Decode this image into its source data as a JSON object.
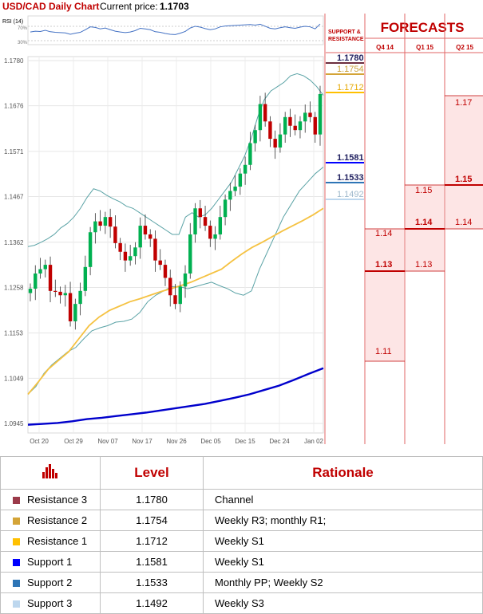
{
  "header": {
    "title": "USD/CAD Daily Chart",
    "price_label": "Current price:",
    "price_value": "1.1703"
  },
  "rsi": {
    "label": "RSI (14)",
    "upper": "70%",
    "lower": "30%"
  },
  "levels_panel": {
    "heading": "SUPPORT & RESISTANCE"
  },
  "forecasts": {
    "title": "FORECASTS",
    "periods": [
      "Q4 14",
      "Q1 15",
      "Q2 15"
    ],
    "columns": [
      {
        "period": "Q4 14",
        "levels": [
          "1.14",
          "1.13",
          "1.11"
        ],
        "bold": "1.13"
      },
      {
        "period": "Q1 15",
        "levels": [
          "1.15",
          "1.14",
          "1.13"
        ],
        "bold": "1.14"
      },
      {
        "period": "Q2 15",
        "levels": [
          "1.17",
          "1.15",
          "1.14"
        ],
        "bold": "1.15"
      }
    ]
  },
  "chart_data": {
    "type": "candlestick",
    "title": "USD/CAD Daily Chart",
    "ylim": [
      1.0945,
      1.178
    ],
    "y_ticks": [
      "1.1780",
      "1.1676",
      "1.1571",
      "1.1467",
      "1.1362",
      "1.1258",
      "1.1153",
      "1.1049",
      "1.0945"
    ],
    "x_ticks": [
      "Oct 20",
      "Oct 29",
      "Nov 07",
      "Nov 17",
      "Nov 26",
      "Dec 05",
      "Dec 15",
      "Dec 24",
      "Jan 02"
    ],
    "closes": [
      1.1255,
      1.129,
      1.13,
      1.131,
      1.125,
      1.1248,
      1.124,
      1.1245,
      1.118,
      1.122,
      1.125,
      1.1305,
      1.1385,
      1.141,
      1.14,
      1.142,
      1.1398,
      1.136,
      1.134,
      1.132,
      1.133,
      1.135,
      1.14,
      1.138,
      1.137,
      1.132,
      1.131,
      1.128,
      1.124,
      1.122,
      1.126,
      1.129,
      1.138,
      1.144,
      1.142,
      1.14,
      1.137,
      1.138,
      1.142,
      1.146,
      1.148,
      1.149,
      1.152,
      1.154,
      1.159,
      1.162,
      1.168,
      1.164,
      1.16,
      1.158,
      1.161,
      1.165,
      1.163,
      1.162,
      1.164,
      1.166,
      1.165,
      1.161,
      1.1703
    ],
    "rsi_values": [
      44,
      47,
      46,
      50,
      45,
      43,
      42,
      41,
      36,
      40,
      43,
      52,
      62,
      60,
      55,
      58,
      52,
      47,
      44,
      42,
      44,
      49,
      57,
      55,
      52,
      45,
      43,
      39,
      36,
      35,
      40,
      46,
      58,
      64,
      61,
      56,
      52,
      55,
      62,
      65,
      66,
      67,
      68,
      69,
      70,
      68,
      71,
      64,
      57,
      55,
      59,
      62,
      59,
      57,
      61,
      64,
      62,
      55,
      72
    ],
    "series": [
      {
        "name": "Bollinger Band upper",
        "color": "#5ba3a6",
        "values": [
          1.1352,
          1.1355,
          1.1362,
          1.137,
          1.138,
          1.1395,
          1.1405,
          1.142,
          1.144,
          1.1465,
          1.1485,
          1.148,
          1.147,
          1.1462,
          1.1455,
          1.1445,
          1.144,
          1.143,
          1.142,
          1.141,
          1.14,
          1.139,
          1.138,
          1.138,
          1.142,
          1.143,
          1.142,
          1.1425,
          1.144,
          1.146,
          1.148,
          1.15,
          1.153,
          1.156,
          1.16,
          1.165,
          1.169,
          1.171,
          1.172,
          1.173,
          1.1745,
          1.175,
          1.1745,
          1.1735,
          1.172,
          1.17
        ]
      },
      {
        "name": "Bollinger Band lower",
        "color": "#5ba3a6",
        "values": [
          1.1012,
          1.103,
          1.106,
          1.108,
          1.1095,
          1.111,
          1.112,
          1.114,
          1.1158,
          1.1165,
          1.117,
          1.1178,
          1.118,
          1.1185,
          1.12,
          1.1225,
          1.124,
          1.125,
          1.126,
          1.126,
          1.1255,
          1.126,
          1.1265,
          1.127,
          1.1262,
          1.1255,
          1.1245,
          1.124,
          1.125,
          1.13,
          1.134,
          1.138,
          1.142,
          1.145,
          1.148,
          1.15,
          1.152,
          1.1535
        ]
      },
      {
        "name": "Moving average fast",
        "color": "#f5c242",
        "values": [
          1.1012,
          1.104,
          1.107,
          1.109,
          1.111,
          1.114,
          1.117,
          1.119,
          1.1205,
          1.1215,
          1.1225,
          1.1232,
          1.124,
          1.1248,
          1.1255,
          1.1262,
          1.127,
          1.128,
          1.129,
          1.13,
          1.1318,
          1.1335,
          1.135,
          1.1362,
          1.1375,
          1.1388,
          1.14,
          1.1412,
          1.1425,
          1.144
        ]
      },
      {
        "name": "Moving average slow",
        "color": "#0000cc",
        "values": [
          1.0942,
          1.0944,
          1.0946,
          1.095,
          1.0955,
          1.0958,
          1.0962,
          1.0966,
          1.097,
          1.0975,
          1.098,
          1.0985,
          1.099,
          1.0997,
          1.1004,
          1.1012,
          1.1022,
          1.1032,
          1.1045,
          1.1059,
          1.1072
        ]
      }
    ],
    "levels": [
      {
        "label": "1.1780",
        "value": 1.178,
        "color": "#6b2d3e"
      },
      {
        "label": "1.1754",
        "value": 1.1754,
        "color": "#d4a437"
      },
      {
        "label": "1.1712",
        "value": 1.1712,
        "color": "#ffc000"
      },
      {
        "label": "1.1581",
        "value": 1.1581,
        "color": "#0000ff"
      },
      {
        "label": "1.1533",
        "value": 1.1533,
        "color": "#2e75b6"
      },
      {
        "label": "1.1492",
        "value": 1.1492,
        "color": "#bdd7ee"
      }
    ],
    "colors": {
      "up": "#00b050",
      "down": "#c00000"
    }
  },
  "table": {
    "headers": [
      "",
      "Level",
      "Rationale"
    ],
    "rows": [
      {
        "name": "Resistance 3",
        "level": "1.1780",
        "rationale": "Channel",
        "color": "#9b3a4a"
      },
      {
        "name": "Resistance 2",
        "level": "1.1754",
        "rationale": "Weekly R3; monthly R1;",
        "color": "#d4a437"
      },
      {
        "name": "Resistance 1",
        "level": "1.1712",
        "rationale": "Weekly S1",
        "color": "#ffc000"
      },
      {
        "name": "Support 1",
        "level": "1.1581",
        "rationale": "Weekly S1",
        "color": "#0000ff"
      },
      {
        "name": "Support 2",
        "level": "1.1533",
        "rationale": "Monthly PP; Weekly S2",
        "color": "#2e75b6"
      },
      {
        "name": "Support 3",
        "level": "1.1492",
        "rationale": "Weekly S3",
        "color": "#bdd7ee"
      }
    ]
  }
}
